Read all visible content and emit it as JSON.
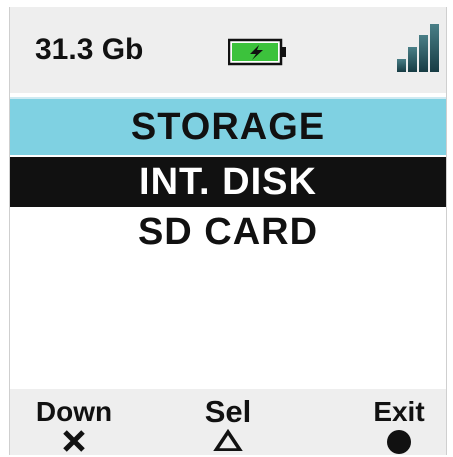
{
  "status_bar": {
    "storage_free": "31.3 Gb",
    "battery_icon": "battery-charging-icon",
    "signal_icon": "signal-strength-icon",
    "battery_color": "#3cc23c"
  },
  "title": "STORAGE",
  "menu": {
    "items": [
      {
        "label": "INT. DISK",
        "selected": true
      },
      {
        "label": "SD CARD",
        "selected": false
      }
    ]
  },
  "softkeys": {
    "down": {
      "label": "Down",
      "icon": "cross-icon"
    },
    "select": {
      "label": "Sel",
      "icon": "triangle-icon"
    },
    "exit": {
      "label": "Exit",
      "icon": "circle-icon"
    }
  },
  "colors": {
    "title_bar": "#7fd1e2",
    "selected_bg": "#111111",
    "status_bg": "#eeeeee"
  }
}
